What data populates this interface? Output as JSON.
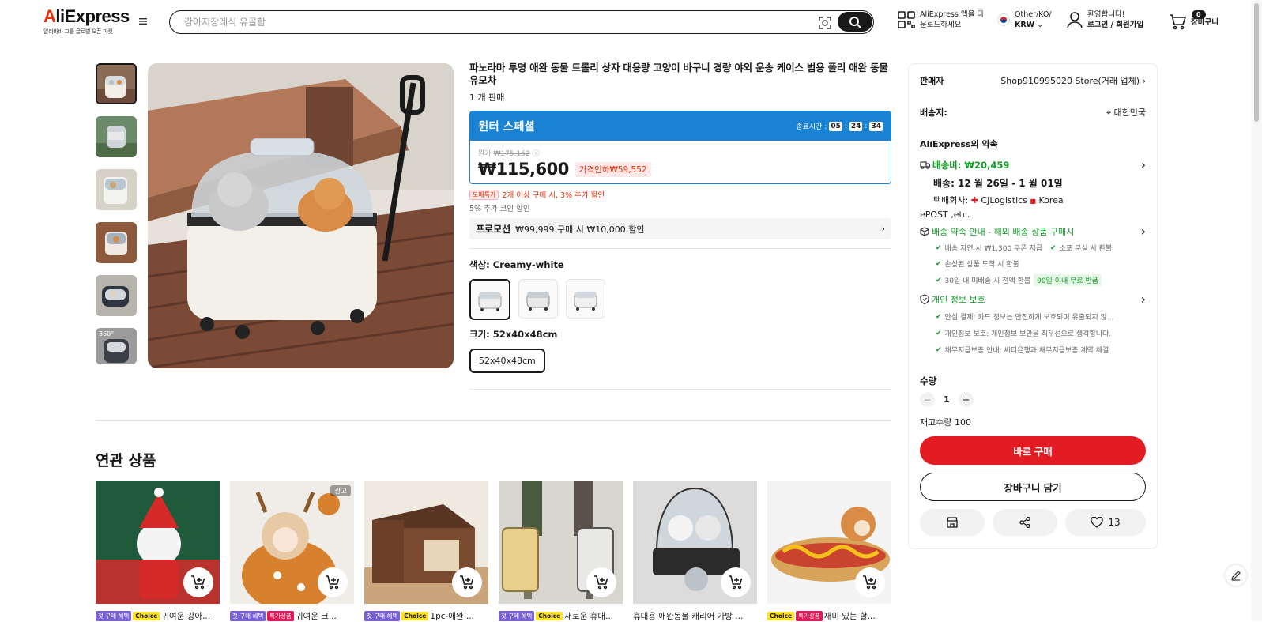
{
  "header": {
    "logo_text": "AliExpress",
    "logo_sub": "알리바바 그룹 글로벌 오픈 마켓",
    "search_placeholder": "강아지장례식 유골함",
    "app_line1": "AliExpress 앱을 다",
    "app_line2": "운로드하세요",
    "region_line1": "Other/KO/",
    "region_line2": "KRW",
    "user_line1": "환영합니다!",
    "user_line2": "로그인 / 회원가입",
    "cart_count": "0",
    "cart_label": "장바구니"
  },
  "product": {
    "title": "파노라마 투명 애완 동물 트롤리 상자 대용량 고양이 바구니 경량 야외 운송 케이스 범용 폴리 애완 동물 유모차",
    "sold": "1 개 판매",
    "promo_name": "윈터 스페셜",
    "timer_label": "종료시간 :",
    "timer_h": "05",
    "timer_m": "24",
    "timer_s": "34",
    "orig_label": "원가",
    "orig_price": "₩175,152",
    "price": "₩115,600",
    "discount": "가격인하₩59,552",
    "deal_tag": "도매특가",
    "deal_text": "2개 이상 구매 시, 3% 추가 할인",
    "coin_text": "5% 추가 코인 할인",
    "promotion_label": "프로모션",
    "promotion_text": "₩99,999 구매 시 ₩10,000 할인",
    "color_label": "색상: Creamy-white",
    "size_label": "크기: 52x40x48cm",
    "size_option": "52x40x48cm"
  },
  "panel": {
    "seller_label": "판매자",
    "seller_name": "Shop910995020 Store(거래 업체)",
    "ship_to_label": "배송지:",
    "ship_to_value": "대한민국",
    "promise_title": "AliExpress의 약속",
    "shipping_fee": "배송비: ₩20,459",
    "delivery": "배송: 12 월 26일 - 1 월 01일",
    "carrier_label": "택배회사:",
    "carrier1": "CJLogistics",
    "carrier2": "Korea",
    "carrier3": "ePOST ,etc.",
    "guarantee_title": "배송 약속 안내 - 해외 배송 상품 구매시",
    "g1": "배송 지연 시 ₩1,300 쿠폰 지급",
    "g2": "소포 분실 시 환불",
    "g3": "손상된 상품 도착 시 환불",
    "g4": "30일 내 미배송 시 전액 환불",
    "g4_tag": "90일 이내 무료 반품",
    "privacy_title": "개인 정보 보호",
    "p1": "안심 결제: 카드 정보는 안전하게 보호되며 유출되지 않...",
    "p2": "개인정보 보호: 개인정보 보안을 최우선으로 생각합니다.",
    "p3": "채무지급보증 안내: 씨티은행과 채무지급보증 계약 체결",
    "qty_label": "수량",
    "qty_value": "1",
    "stock": "재고수량 100",
    "buy_now": "바로 구매",
    "add_cart": "장바구니 담기",
    "wish_count": "13"
  },
  "related": {
    "title": "연관 상품",
    "items": [
      {
        "first": "첫 구매 혜택",
        "badge": "Choice",
        "name": "귀여운 강아..."
      },
      {
        "first": "첫 구매 혜택",
        "badge": "특가상품",
        "name": "귀여운 크...",
        "ad": "광고"
      },
      {
        "first": "첫 구매 혜택",
        "badge": "Choice",
        "name": "1pc-애완 ..."
      },
      {
        "first": "첫 구매 혜택",
        "badge": "Choice",
        "name": "새로운 휴대..."
      },
      {
        "name": "휴대용 애완동물 캐리어 가방 ..."
      },
      {
        "badge": "Choice",
        "badge2": "특가상품",
        "name": "재미 있는 할..."
      }
    ]
  },
  "colors": {
    "brand_red": "#e31b23",
    "promo_blue": "#1a82d3",
    "green": "#0f9d24"
  }
}
